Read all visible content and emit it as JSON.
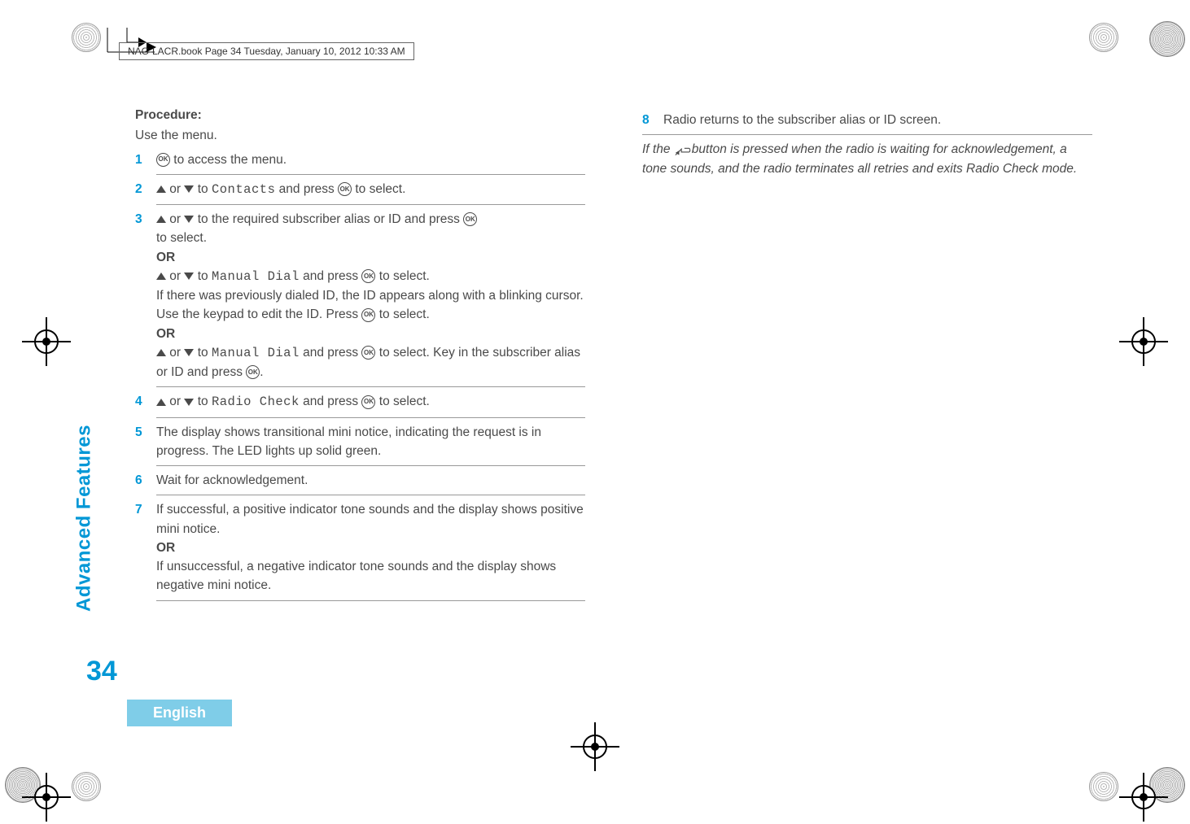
{
  "header": {
    "stamp": "NAG-LACR.book  Page 34  Tuesday, January 10, 2012  10:33 AM"
  },
  "sidebar": {
    "section": "Advanced Features",
    "page_number": "34",
    "language": "English"
  },
  "left": {
    "procedure_label": "Procedure:",
    "intro": "Use the menu.",
    "steps": {
      "s1": {
        "num": "1",
        "text_after_icon": " to access the menu."
      },
      "s2": {
        "num": "2",
        "or": " or ",
        "to": " to ",
        "contacts": "Contacts",
        "andpress": " and press ",
        "select": " to select."
      },
      "s3": {
        "num": "3",
        "or": " or ",
        "to_required": " to the required subscriber alias or ID and press ",
        "to_select": "to select.",
        "OR1": "OR",
        "manual1_to": " to ",
        "manual1_label": "Manual Dial",
        "manual1_press": " and press ",
        "manual1_select": " to select.",
        "manual1_body": "If there was previously dialed ID, the ID appears along with a blinking cursor. Use the keypad to edit the ID. Press ",
        "manual1_tail": " to select.",
        "OR2": "OR",
        "manual2_to": " to ",
        "manual2_label": "Manual Dial",
        "manual2_press": " and press ",
        "manual2_afterselect": " to select. Key in the subscriber alias or ID and press ",
        "manual2_period": "."
      },
      "s4": {
        "num": "4",
        "or": " or ",
        "to": " to ",
        "radio_check": "Radio Check",
        "andpress": " and press ",
        "select": " to select."
      },
      "s5": {
        "num": "5",
        "body": "The display shows transitional mini notice, indicating the request is in progress. The LED lights up solid green."
      },
      "s6": {
        "num": "6",
        "body": "Wait for acknowledgement."
      },
      "s7": {
        "num": "7",
        "success": "If successful, a positive indicator tone sounds and the display shows positive mini notice.",
        "OR": "OR",
        "fail": "If unsuccessful, a negative indicator tone sounds and the display shows negative mini notice."
      }
    }
  },
  "right": {
    "s8": {
      "num": "8",
      "body": "Radio returns to the subscriber alias or ID screen."
    },
    "note_prefix": "If the ",
    "note_suffix": "button is pressed when the radio is waiting for acknowledgement, a tone sounds, and the radio terminates all retries and exits Radio Check mode."
  },
  "icons": {
    "ok_glyph": "OK"
  }
}
